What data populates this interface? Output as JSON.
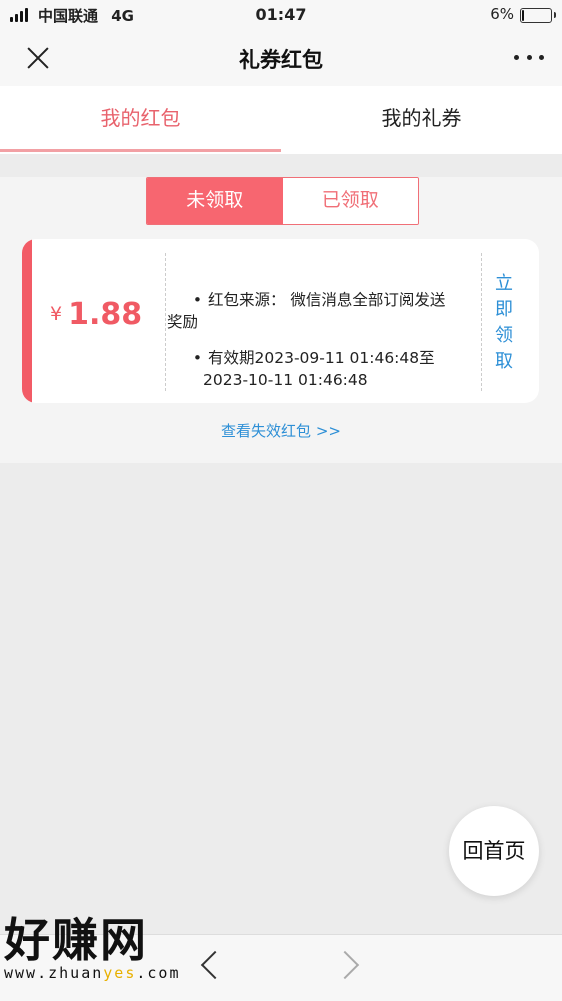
{
  "status_bar": {
    "carrier": "中国联通",
    "network": "4G",
    "time": "01:47",
    "battery": "6%",
    "battery_level": 0.06
  },
  "nav": {
    "title": "礼券红包",
    "close_icon": "close-icon",
    "more_icon": "more-icon"
  },
  "tabs": [
    {
      "label": "我的红包",
      "active": true
    },
    {
      "label": "我的礼券",
      "active": false
    }
  ],
  "segment": {
    "unclaimed": "未领取",
    "claimed": "已领取",
    "selected": "未领取"
  },
  "card": {
    "currency": "¥",
    "amount": "1.88",
    "source_bullet": "•",
    "source_line1": "红包来源：  微信消息全部订阅发送",
    "source_line2": "奖励",
    "validity_bullet": "•",
    "validity_line1": "有效期2023-09-11 01:46:48至",
    "validity_line2": "2023-10-11 01:46:48",
    "claim_chars": [
      "立",
      "即",
      "领",
      "取"
    ]
  },
  "expired_link": "查看失效红包 >>",
  "home_button": "回首页",
  "watermark": {
    "big": "好赚网",
    "small_prefix": "www.zhuan",
    "small_highlight": "yes",
    "small_suffix": ".com"
  },
  "colors": {
    "accent": "#f25b66",
    "link": "#2d8fd6",
    "background": "#ececec"
  }
}
